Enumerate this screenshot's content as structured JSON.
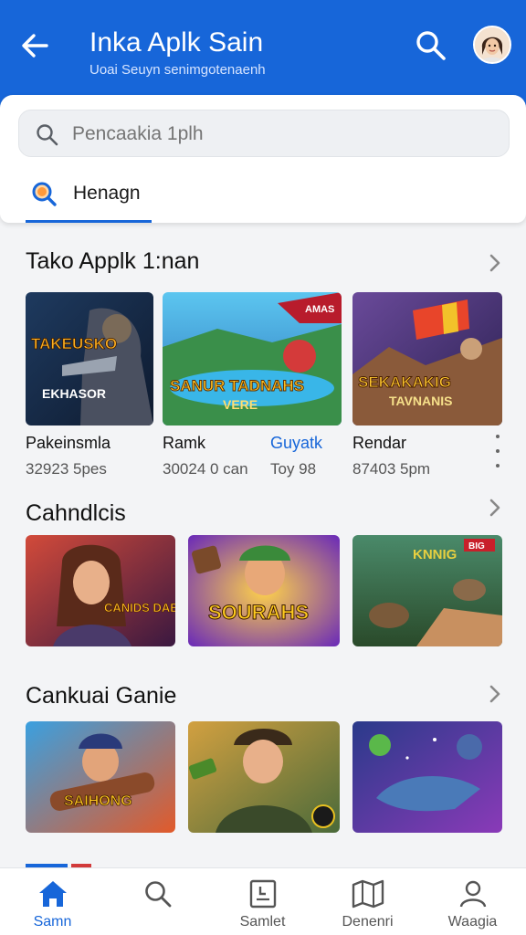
{
  "header": {
    "title": "Inka Aplk Sain",
    "subtitle": "Uoai Seuyn senimgotenaenh",
    "background": "#1766d9",
    "icons": {
      "back": "arrow-left-icon",
      "search": "search-icon",
      "avatar": "user-avatar"
    }
  },
  "search": {
    "placeholder": "Pencaakia 1plh",
    "tab_label": "Henagn",
    "icon": "search-icon"
  },
  "sections": [
    {
      "title": "Tako Applk 1:nan",
      "items": [
        {
          "art_title": "TAKEUSKO",
          "art_subtitle": "EKHASOR",
          "name": "Pakeinsmla",
          "meta": "32923 5pes"
        },
        {
          "art_title": "SANUR TADNAHS",
          "art_subtitle": "VERE",
          "art_badge": "AMAS",
          "name": "Ramk",
          "meta": "30024 0 can"
        },
        {
          "name": "Guyatk",
          "meta": "Toy 98"
        },
        {
          "art_title": "SEKAKAKIG",
          "art_subtitle": "TAVNANIS",
          "name": "Rendar",
          "meta": "87403 5pm"
        }
      ]
    },
    {
      "title": "Cahndlcis",
      "items": [
        {
          "art_title": "CANIDS DABION"
        },
        {
          "art_title": "SOURAHS"
        },
        {
          "art_title": "KNNIG",
          "art_badge": "BIG"
        }
      ]
    },
    {
      "title": "Cankuai Ganie",
      "items": [
        {
          "art_title": "SAIHONG"
        },
        {
          "art_title": ""
        },
        {
          "art_title": ""
        }
      ]
    }
  ],
  "bottom_nav": [
    {
      "label": "Samn",
      "icon": "home-icon",
      "active": true
    },
    {
      "label": "",
      "icon": "search-icon",
      "active": false
    },
    {
      "label": "Samlet",
      "icon": "document-icon",
      "active": false
    },
    {
      "label": "Denenri",
      "icon": "map-icon",
      "active": false
    },
    {
      "label": "Waagia",
      "icon": "user-icon",
      "active": false
    }
  ],
  "colors": {
    "accent": "#1766d9",
    "background": "#f3f4f6",
    "card": "#ffffff"
  }
}
